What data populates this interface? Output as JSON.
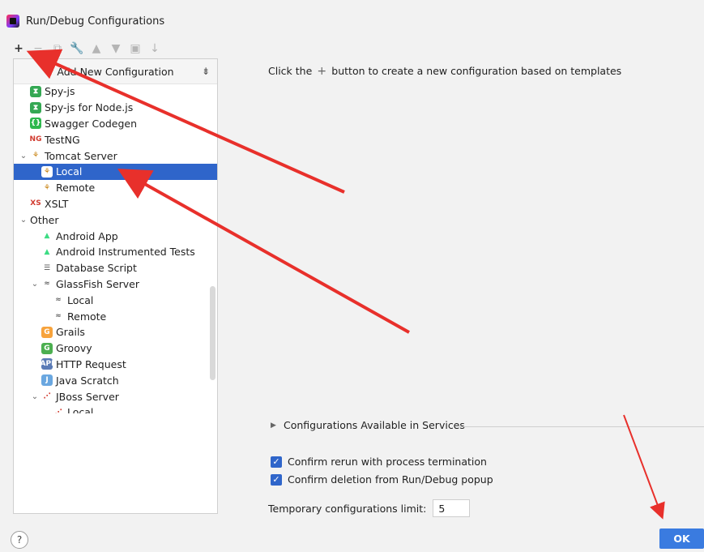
{
  "window": {
    "title": "Run/Debug Configurations"
  },
  "toolbar": {
    "items": [
      {
        "name": "add-icon",
        "glyph": "+",
        "state": "enabled"
      },
      {
        "name": "remove-icon",
        "glyph": "−",
        "state": "disabled"
      },
      {
        "name": "copy-icon",
        "glyph": "⧉",
        "state": "disabled"
      },
      {
        "name": "wrench-icon",
        "glyph": "🔧",
        "state": "enabled"
      },
      {
        "name": "move-up-icon",
        "glyph": "▲",
        "state": "disabled"
      },
      {
        "name": "move-down-icon",
        "glyph": "▼",
        "state": "disabled"
      },
      {
        "name": "folder-icon",
        "glyph": "▣",
        "state": "disabled"
      },
      {
        "name": "sort-icon",
        "glyph": "↓",
        "state": "disabled"
      }
    ]
  },
  "tree": {
    "header": "Add New Configuration",
    "rows": [
      {
        "indent": 1,
        "caret": "",
        "icon": "spy-js-icon",
        "text": "Spy-js"
      },
      {
        "indent": 1,
        "caret": "",
        "icon": "spy-js-node-icon",
        "text": "Spy-js for Node.js"
      },
      {
        "indent": 1,
        "caret": "",
        "icon": "swagger-icon",
        "text": "Swagger Codegen"
      },
      {
        "indent": 1,
        "caret": "",
        "icon": "testng-icon",
        "text": "TestNG"
      },
      {
        "indent": 0,
        "caret": "⌄",
        "icon": "tomcat-icon",
        "text": "Tomcat Server"
      },
      {
        "indent": 2,
        "caret": "",
        "icon": "tomcat-local-icon",
        "text": "Local",
        "selected": true
      },
      {
        "indent": 2,
        "caret": "",
        "icon": "tomcat-remote-icon",
        "text": "Remote"
      },
      {
        "indent": 1,
        "caret": "",
        "icon": "xslt-icon",
        "text": "XSLT"
      },
      {
        "indent": 0,
        "caret": "⌄",
        "icon": "",
        "text": "Other"
      },
      {
        "indent": 2,
        "caret": "",
        "icon": "android-icon",
        "text": "Android App"
      },
      {
        "indent": 2,
        "caret": "",
        "icon": "android-tests-icon",
        "text": "Android Instrumented Tests"
      },
      {
        "indent": 2,
        "caret": "",
        "icon": "database-script-icon",
        "text": "Database Script"
      },
      {
        "indent": 1,
        "caret": "⌄",
        "icon": "glassfish-icon",
        "text": "GlassFish Server"
      },
      {
        "indent": 3,
        "caret": "",
        "icon": "glassfish-local-icon",
        "text": "Local"
      },
      {
        "indent": 3,
        "caret": "",
        "icon": "glassfish-remote-icon",
        "text": "Remote"
      },
      {
        "indent": 2,
        "caret": "",
        "icon": "grails-icon",
        "text": "Grails"
      },
      {
        "indent": 2,
        "caret": "",
        "icon": "groovy-icon",
        "text": "Groovy"
      },
      {
        "indent": 2,
        "caret": "",
        "icon": "http-request-icon",
        "text": "HTTP Request"
      },
      {
        "indent": 2,
        "caret": "",
        "icon": "java-scratch-icon",
        "text": "Java Scratch"
      },
      {
        "indent": 1,
        "caret": "⌄",
        "icon": "jboss-icon",
        "text": "JBoss Server"
      },
      {
        "indent": 3,
        "caret": "",
        "icon": "jboss-local-icon",
        "text": "Local"
      }
    ]
  },
  "main": {
    "hint_before": "Click the",
    "hint_after": "button to create a new configuration based on templates",
    "services_label": "Configurations Available in Services",
    "confirm_rerun_label": "Confirm rerun with process termination",
    "confirm_delete_label": "Confirm deletion from Run/Debug popup",
    "limit_label": "Temporary configurations limit:",
    "limit_value": "5"
  },
  "footer": {
    "help": "?",
    "ok": "OK"
  },
  "colors": {
    "selection": "#2f65ca",
    "accent": "#3a7be0",
    "annotation": "#e8302b"
  }
}
